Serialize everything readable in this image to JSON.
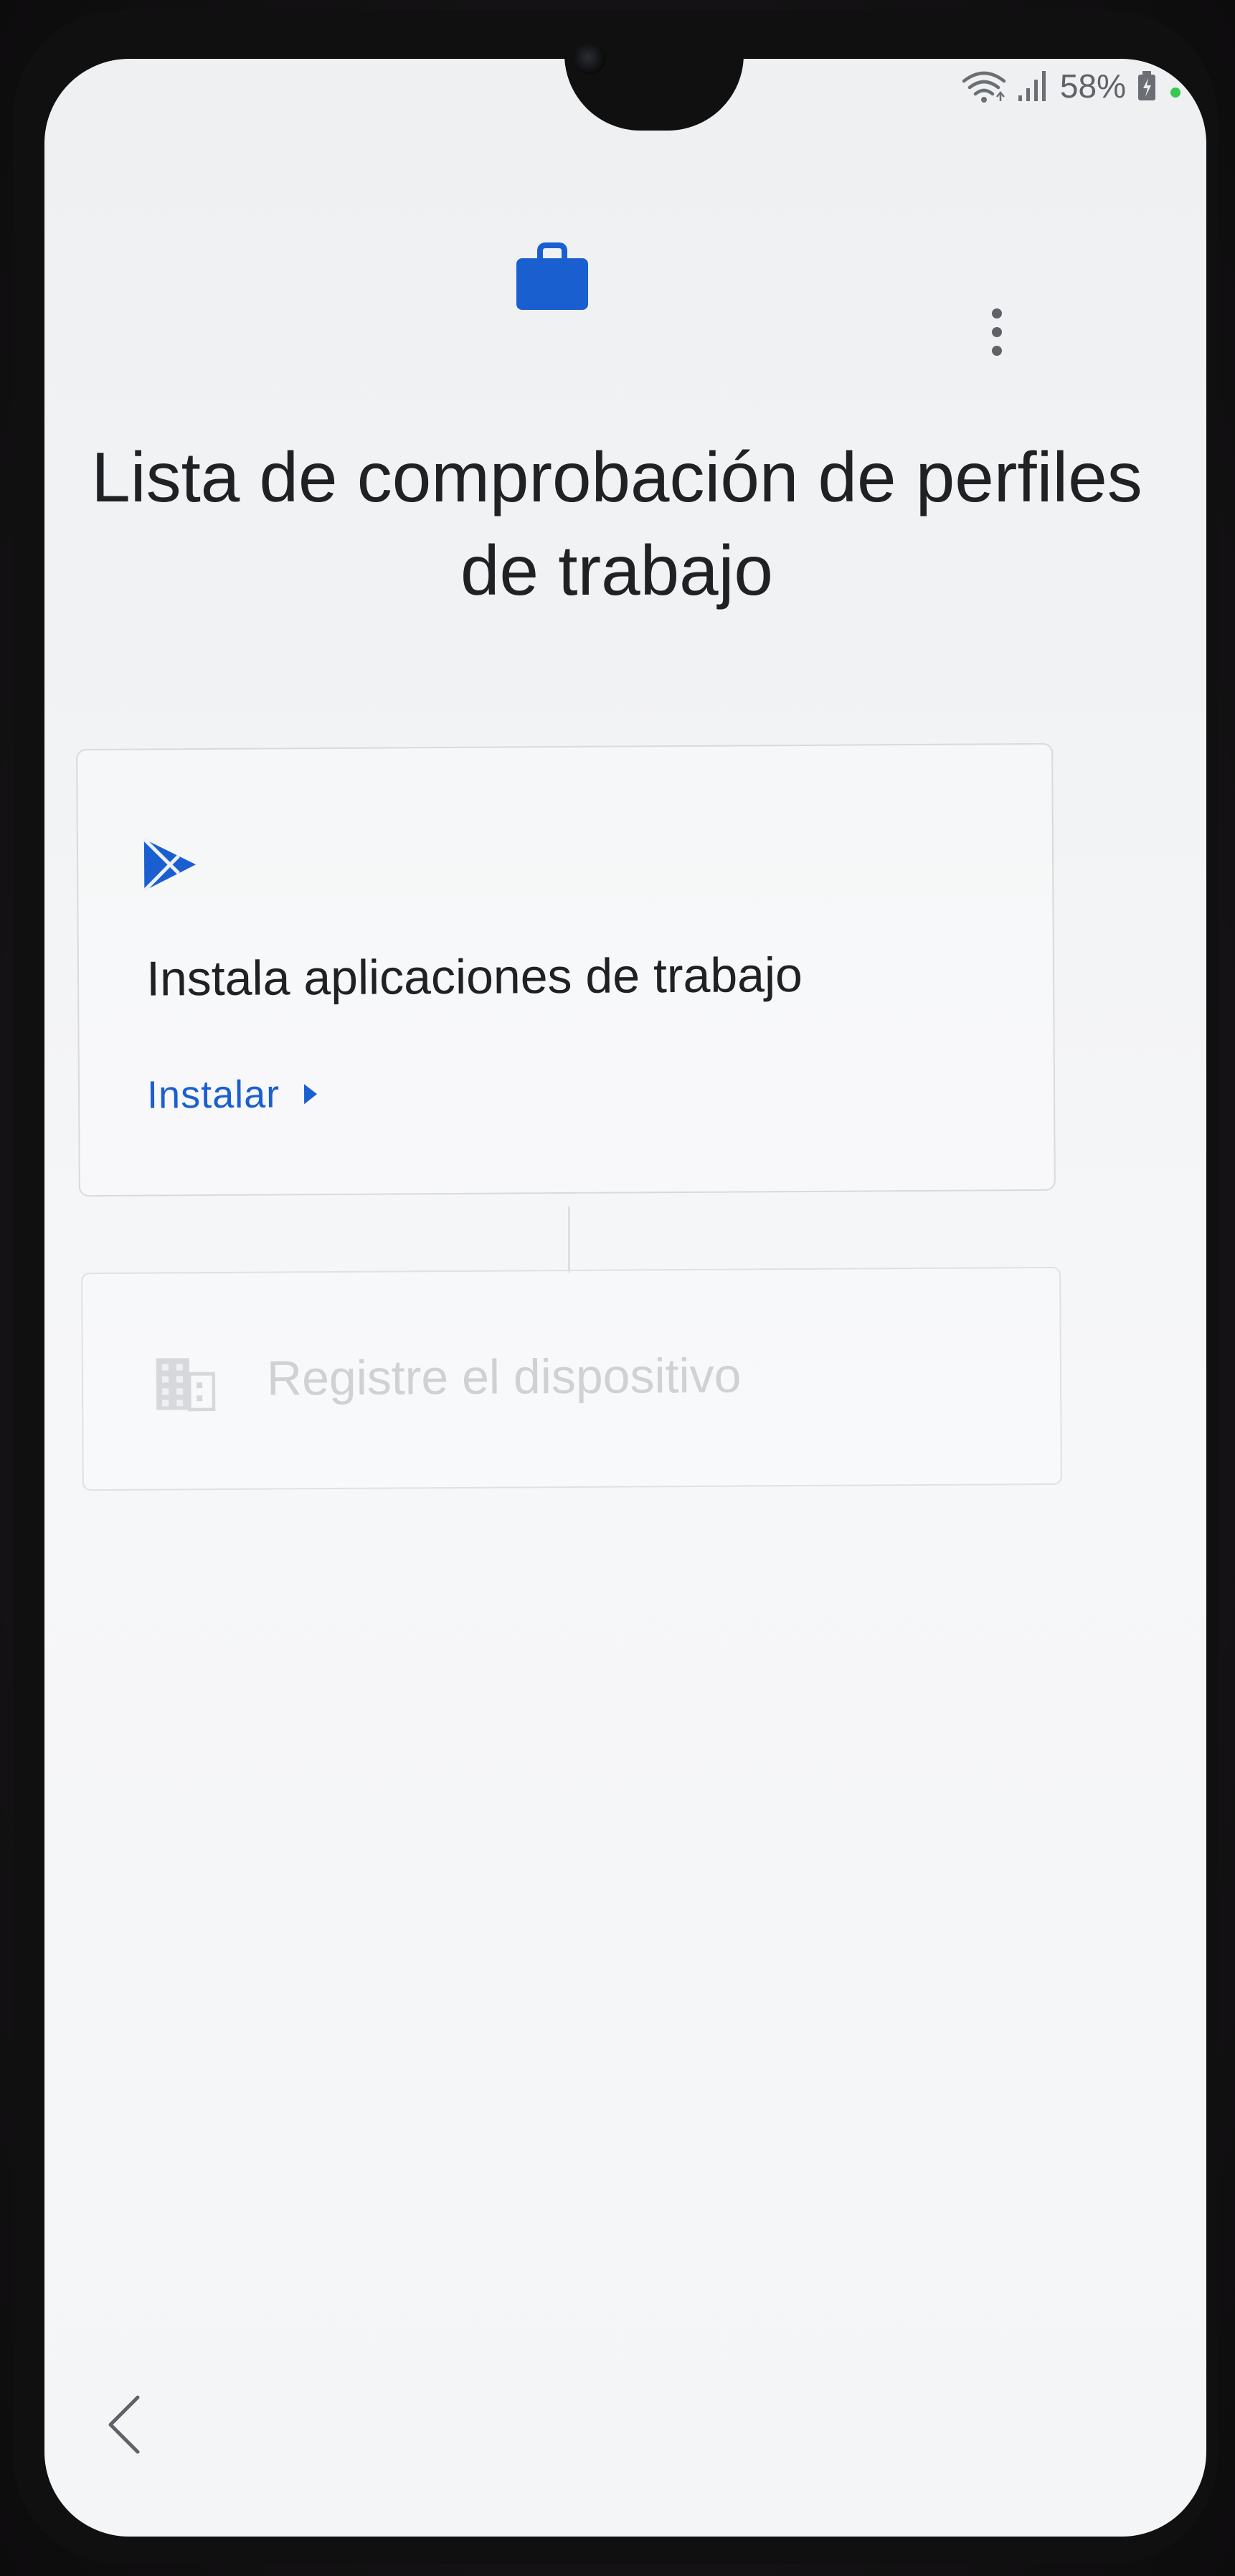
{
  "status_bar": {
    "battery_percent": "58%",
    "icons": [
      "wifi-icon",
      "signal-icon",
      "battery-icon",
      "privacy-dot"
    ],
    "privacy_dot_color": "#37c84f"
  },
  "header": {
    "icon": "briefcase-icon",
    "icon_color": "#1a5fd0",
    "menu_icon": "more-vert-icon"
  },
  "page": {
    "title": "Lista de comprobación de perfiles de trabajo"
  },
  "checklist": [
    {
      "icon": "play-store-icon",
      "title": "Instala aplicaciones de trabajo",
      "action_label": "Instalar",
      "action_icon": "arrow-right-icon",
      "state": "active"
    },
    {
      "icon": "building-icon",
      "title": "Registre el dispositivo",
      "state": "disabled"
    }
  ],
  "navigation": {
    "back_icon": "chevron-left-icon"
  },
  "colors": {
    "accent": "#1a5fd0",
    "text_primary": "#202124",
    "text_disabled": "#cfd1d4"
  }
}
